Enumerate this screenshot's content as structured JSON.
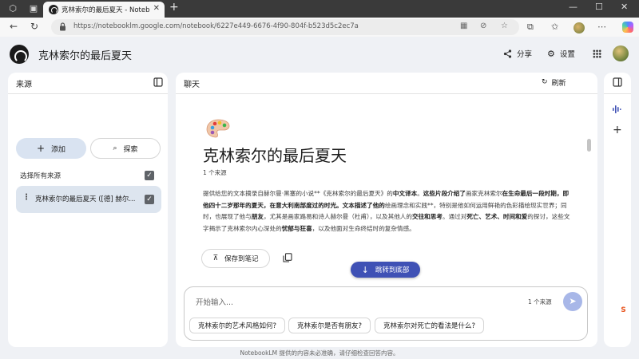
{
  "browser": {
    "tab_title": "克林索尔的最后夏天 - NotebookLM",
    "url": "https://notebooklm.google.com/notebook/6227e449-6676-4f90-804f-b523d5c2ec7a",
    "extension_badge": "S"
  },
  "app": {
    "title": "克林索尔的最后夏天",
    "share_label": "分享",
    "settings_label": "设置"
  },
  "sources": {
    "title": "来源",
    "add_label": "添加",
    "explore_label": "探索",
    "select_all_label": "选择所有来源",
    "items": [
      {
        "label": "克林索尔的最后夏天 ([德] 赫尔..."
      }
    ]
  },
  "chat": {
    "title": "聊天",
    "refresh_label": "刷新",
    "notebook_title": "克林索尔的最后夏天",
    "source_count": "1 个来源",
    "summary_parts": [
      {
        "text": "提供给您的文本摘录自赫尔曼·黑塞的小说**《克林索尔的最后夏天》的",
        "bold": false
      },
      {
        "text": "中文译本",
        "bold": true
      },
      {
        "text": "。",
        "bold": false
      },
      {
        "text": "这些片段介绍了",
        "bold": true
      },
      {
        "text": "画家克林索尔",
        "bold": false
      },
      {
        "text": "在生命最后一段时期，即他四十二岁那年的夏天，在意大利南部度过的时光。文本描述了他的",
        "bold": true
      },
      {
        "text": "绘画理念和实践**，特别是他如何运用鲜艳的色彩描绘现实世界；同时，也展现了他与",
        "bold": false
      },
      {
        "text": "朋友",
        "bold": true
      },
      {
        "text": "，尤其是画家路易和诗人赫尔曼（杜甫），以及其他人的",
        "bold": false
      },
      {
        "text": "交往和思考",
        "bold": true
      },
      {
        "text": "。通过对",
        "bold": false
      },
      {
        "text": "死亡、艺术、时间和爱",
        "bold": true
      },
      {
        "text": "的探讨，这些文字揭示了克林索尔内心深处的",
        "bold": false
      },
      {
        "text": "忧郁与狂喜",
        "bold": true
      },
      {
        "text": "，以及他面对生命终结时的复杂情感。",
        "bold": false
      }
    ],
    "save_note_label": "保存到笔记",
    "jump_label": "跳转到底部",
    "input_placeholder": "开始输入...",
    "input_source_count": "1 个来源",
    "suggestions": [
      "克林索尔的艺术风格如何?",
      "克林索尔是否有朋友?",
      "克林索尔对死亡的看法是什么?"
    ]
  },
  "footer_note": "NotebookLM 提供的内容未必准确，请仔细检查回答内容。",
  "colors": {
    "accent": "#3f51b5",
    "add_button_bg": "#d9e3f1",
    "selected_row_bg": "#dde5ef",
    "app_bg": "#eff1f5"
  }
}
